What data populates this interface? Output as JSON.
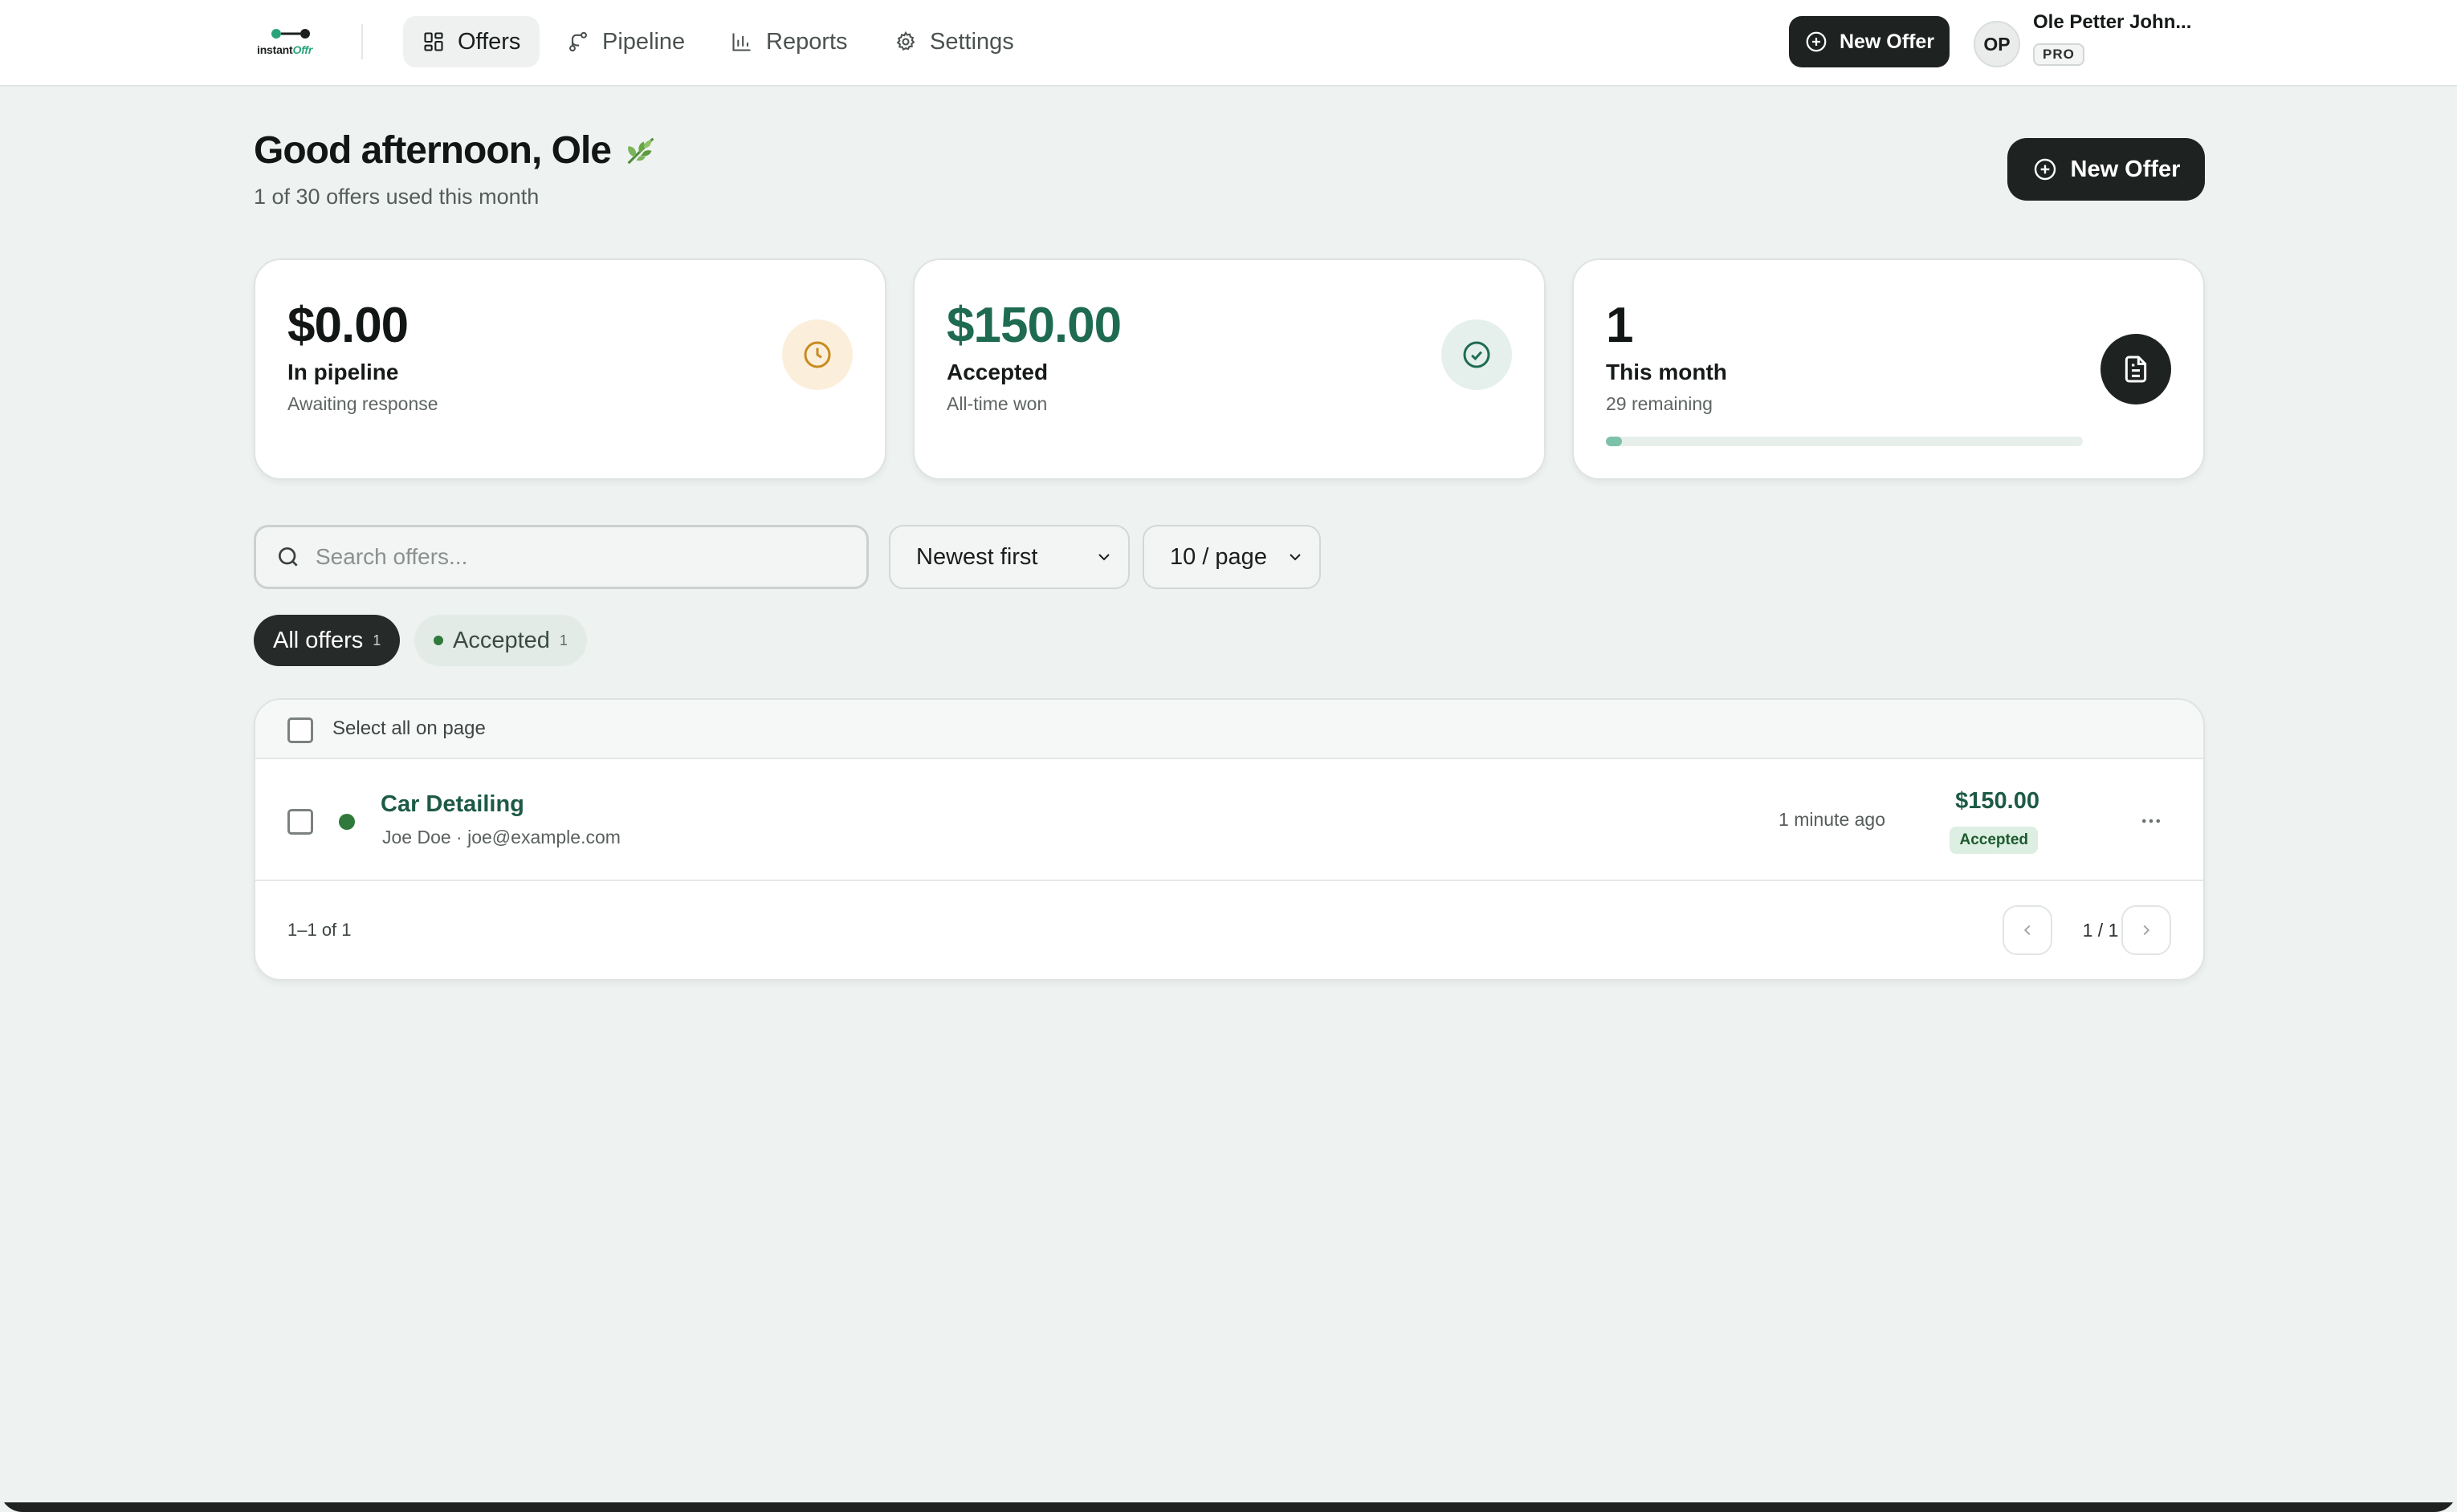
{
  "brand": {
    "name_prefix": "instant",
    "name_accent": "Offr"
  },
  "nav": {
    "items": [
      {
        "label": "Offers",
        "icon": "grid-icon",
        "active": true
      },
      {
        "label": "Pipeline",
        "icon": "branch-icon",
        "active": false
      },
      {
        "label": "Reports",
        "icon": "bar-chart-icon",
        "active": false
      },
      {
        "label": "Settings",
        "icon": "gear-icon",
        "active": false
      }
    ],
    "new_offer_label": "New Offer"
  },
  "user": {
    "initials": "OP",
    "name": "Ole Petter John...",
    "plan": "PRO"
  },
  "header": {
    "greeting": "Good afternoon, Ole",
    "greeting_icon": "leaf-icon",
    "usage": "1 of 30 offers used this month",
    "new_offer_label": "New Offer"
  },
  "stats": [
    {
      "value": "$0.00",
      "label": "In pipeline",
      "sub": "Awaiting response",
      "icon": "clock-icon",
      "color": "#c98a1e"
    },
    {
      "value": "$150.00",
      "label": "Accepted",
      "sub": "All-time won",
      "icon": "check-circle-icon",
      "color": "#1f6b52"
    },
    {
      "value": "1",
      "label": "This month",
      "sub": "29 remaining",
      "icon": "document-icon",
      "progress": 0.033
    }
  ],
  "filters": {
    "search_placeholder": "Search offers...",
    "sort_value": "Newest first",
    "page_size_value": "10 / page"
  },
  "tabs": [
    {
      "label": "All offers",
      "count": "1",
      "active": true
    },
    {
      "label": "Accepted",
      "count": "1",
      "active": false
    }
  ],
  "table": {
    "select_all_label": "Select all on page",
    "rows": [
      {
        "title": "Car Detailing",
        "subtitle": "Joe Doe · joe@example.com",
        "time": "1 minute ago",
        "amount": "$150.00",
        "status": "Accepted"
      }
    ],
    "range": "1–1 of 1",
    "page": "1 / 1"
  },
  "colors": {
    "accent": "#1f6b52",
    "dark": "#1e2220",
    "background": "#eef2f0"
  }
}
